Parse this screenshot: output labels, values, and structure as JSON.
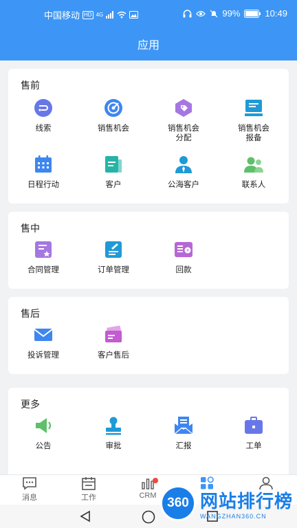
{
  "status": {
    "carrier": "中国移动",
    "hd": "HD",
    "net": "4G",
    "battery": "99%",
    "time": "10:49"
  },
  "header": {
    "title": "应用"
  },
  "sections": {
    "presale": {
      "title": "售前",
      "items": [
        "线索",
        "销售机会",
        "销售机会\n分配",
        "销售机会\n报备",
        "日程行动",
        "客户",
        "公海客户",
        "联系人"
      ]
    },
    "insale": {
      "title": "售中",
      "items": [
        "合同管理",
        "订单管理",
        "回款"
      ]
    },
    "aftersale": {
      "title": "售后",
      "items": [
        "投诉管理",
        "客户售后"
      ]
    },
    "more": {
      "title": "更多",
      "items": [
        "公告",
        "审批",
        "汇报",
        "工单"
      ]
    }
  },
  "nav": {
    "items": [
      "消息",
      "工作",
      "CRM",
      "",
      ""
    ]
  },
  "watermark": {
    "logo": "360",
    "text": "网站排行榜",
    "sub": "WANGZHAN360.CN"
  },
  "colors": {
    "primary": "#3d96f5",
    "background": "#f1f2f4",
    "card": "#ffffff"
  }
}
